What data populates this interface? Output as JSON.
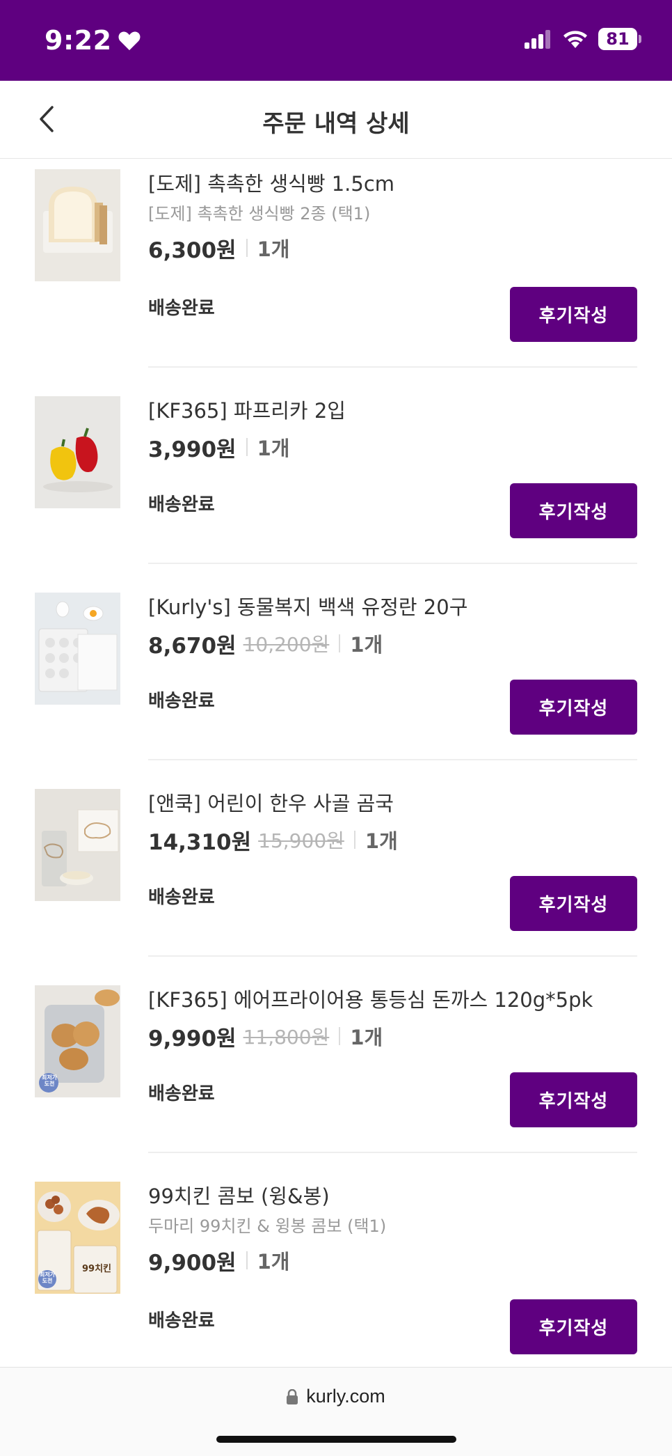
{
  "status_bar": {
    "time": "9:22",
    "battery": "81"
  },
  "header": {
    "title": "주문 내역 상세"
  },
  "items": [
    {
      "name": "[도제] 촉촉한 생식빵 1.5cm",
      "option": "[도제] 촉촉한 생식빵 2종 (택1)",
      "price": "6,300원",
      "original_price": "",
      "quantity": "1개",
      "status": "배송완료",
      "button": "후기작성",
      "thumb": "bread"
    },
    {
      "name": "[KF365] 파프리카 2입",
      "option": "",
      "price": "3,990원",
      "original_price": "",
      "quantity": "1개",
      "status": "배송완료",
      "button": "후기작성",
      "thumb": "paprika"
    },
    {
      "name": "[Kurly's] 동물복지 백색 유정란 20구",
      "option": "",
      "price": "8,670원",
      "original_price": "10,200원",
      "quantity": "1개",
      "status": "배송완료",
      "button": "후기작성",
      "thumb": "eggs"
    },
    {
      "name": "[앤쿡] 어린이 한우 사골 곰국",
      "option": "",
      "price": "14,310원",
      "original_price": "15,900원",
      "quantity": "1개",
      "status": "배송완료",
      "button": "후기작성",
      "thumb": "soup"
    },
    {
      "name": "[KF365] 에어프라이어용 통등심 돈까스 120g*5pk",
      "option": "",
      "price": "9,990원",
      "original_price": "11,800원",
      "quantity": "1개",
      "status": "배송완료",
      "button": "후기작성",
      "thumb": "cutlet",
      "thumb_badge": "최저가 도전"
    },
    {
      "name": "99치킨 콤보 (윙&봉)",
      "option": "두마리 99치킨 & 윙봉 콤보 (택1)",
      "price": "9,900원",
      "original_price": "",
      "quantity": "1개",
      "status": "배송완료",
      "button": "후기작성",
      "thumb": "chicken",
      "thumb_badge": "최저가 도전",
      "thumb_text": "99치킨"
    }
  ],
  "browser": {
    "url": "kurly.com"
  },
  "colors": {
    "brand": "#5f0080",
    "text": "#333333",
    "muted": "#999999"
  }
}
